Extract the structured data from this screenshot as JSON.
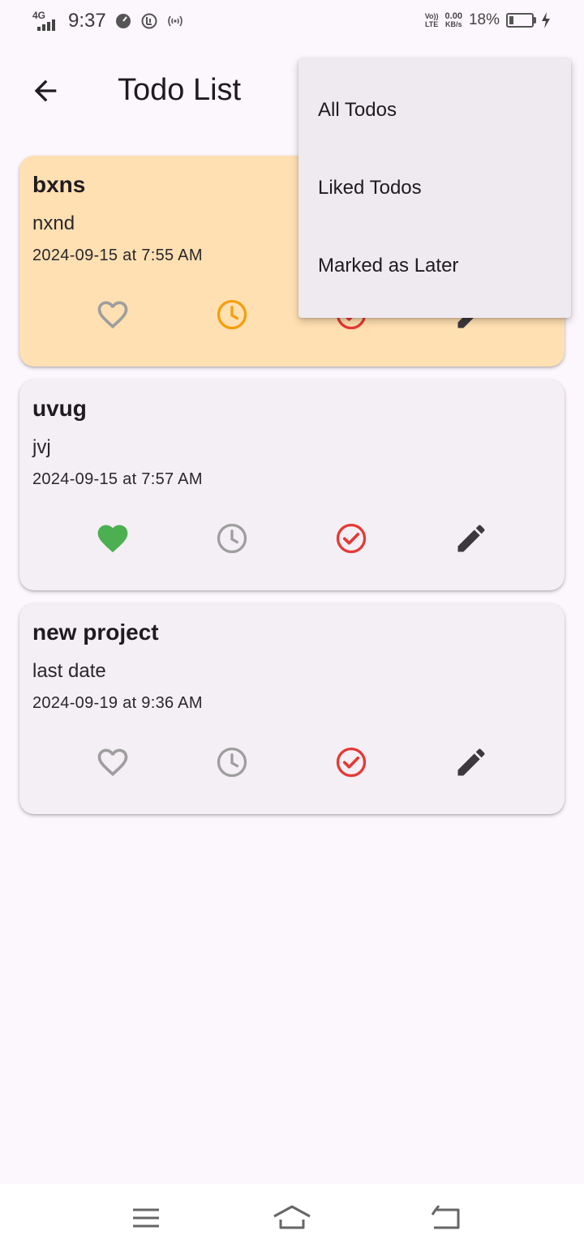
{
  "status_bar": {
    "network": "4G",
    "time": "9:37",
    "volte_top": "Vo))",
    "volte_bottom": "LTE",
    "speed_value": "0.00",
    "speed_unit": "KB/s",
    "battery": "18%",
    "battery_level": 0.18
  },
  "app_bar": {
    "title": "Todo List"
  },
  "todos": [
    {
      "title": "bxns",
      "description": "nxnd",
      "datetime": "2024-09-15 at 7:55 AM",
      "liked": false,
      "later": true,
      "highlighted": true
    },
    {
      "title": "uvug",
      "description": "jvj",
      "datetime": "2024-09-15 at 7:57 AM",
      "liked": true,
      "later": false,
      "highlighted": false
    },
    {
      "title": "new project",
      "description": "last date",
      "datetime": "2024-09-19 at 9:36 AM",
      "liked": false,
      "later": false,
      "highlighted": false
    }
  ],
  "filter_menu": {
    "items": [
      {
        "label": "All Todos"
      },
      {
        "label": "Liked Todos"
      },
      {
        "label": "Marked as Later"
      }
    ]
  },
  "colors": {
    "liked": "#4caf50",
    "later_active": "#f59e0b",
    "done": "#e53935",
    "inactive": "#9e9e9e",
    "edit": "#3d383e",
    "highlight_card": "#ffe0b2"
  },
  "icons": [
    "back-arrow-icon",
    "heart-icon",
    "clock-icon",
    "check-circle-icon",
    "pencil-icon",
    "menu-icon",
    "home-icon",
    "return-icon"
  ]
}
